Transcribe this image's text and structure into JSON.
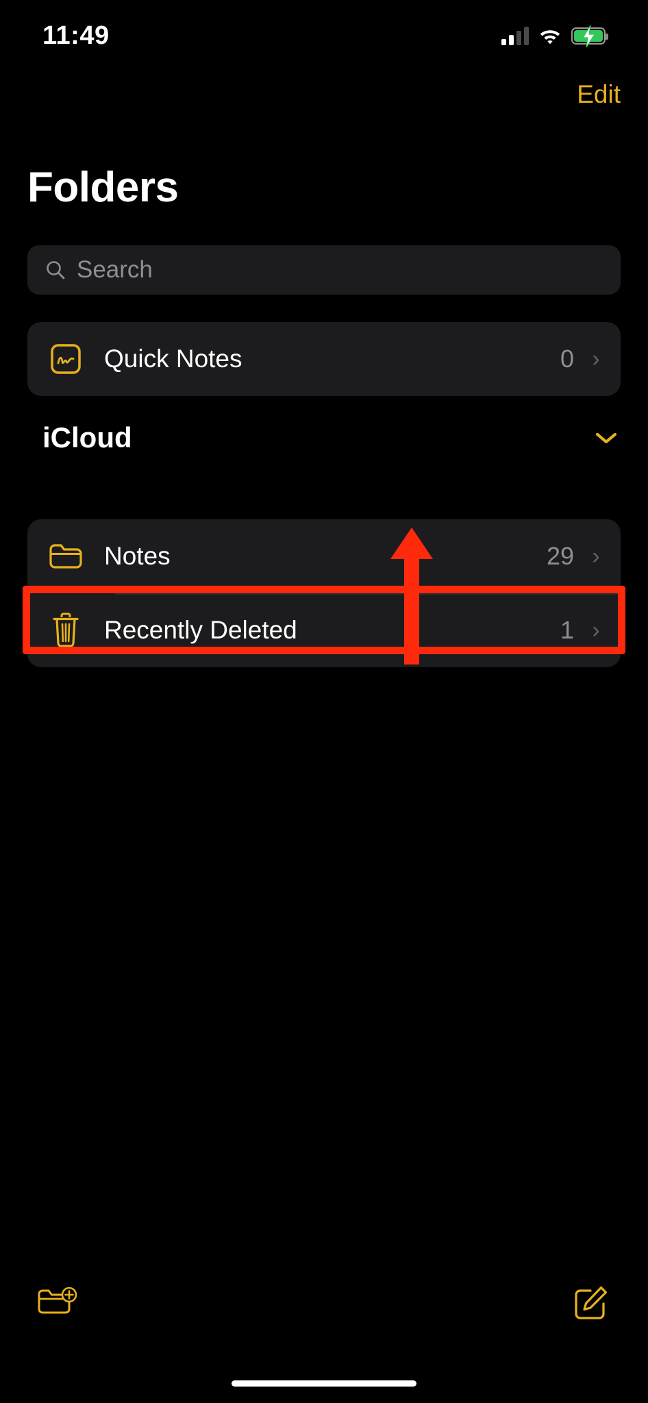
{
  "status_bar": {
    "time": "11:49",
    "signal_icon": "cellular-signal-icon",
    "signal_bars_filled": 2,
    "signal_bars_total": 4,
    "wifi_icon": "wifi-icon",
    "battery_icon": "battery-charging-icon",
    "battery_charging": true,
    "battery_color": "#34c759"
  },
  "navbar": {
    "edit_label": "Edit",
    "accent_color": "#e8b11c"
  },
  "page_title": "Folders",
  "search": {
    "placeholder": "Search",
    "value": "",
    "icon": "search-icon"
  },
  "quick_notes": {
    "label": "Quick Notes",
    "count": "0",
    "icon": "quick-note-scribble-icon",
    "chevron": "›"
  },
  "section": {
    "title": "iCloud",
    "collapse_icon": "chevron-down-icon",
    "rows": [
      {
        "label": "Notes",
        "count": "29",
        "icon": "folder-icon",
        "chevron": "›"
      },
      {
        "label": "Recently Deleted",
        "count": "1",
        "icon": "trash-icon",
        "chevron": "›"
      }
    ]
  },
  "toolbar": {
    "new_folder_label": "new-folder-icon",
    "compose_label": "compose-icon"
  },
  "annotation": {
    "highlight_color": "#ff2a0c",
    "highlight_target": "Recently Deleted",
    "arrow_direction": "up"
  },
  "colors": {
    "background": "#000000",
    "card": "#1c1c1e",
    "accent_yellow": "#e8b11c",
    "secondary_text": "#8e8e93",
    "annotation_red": "#ff2a0c"
  }
}
